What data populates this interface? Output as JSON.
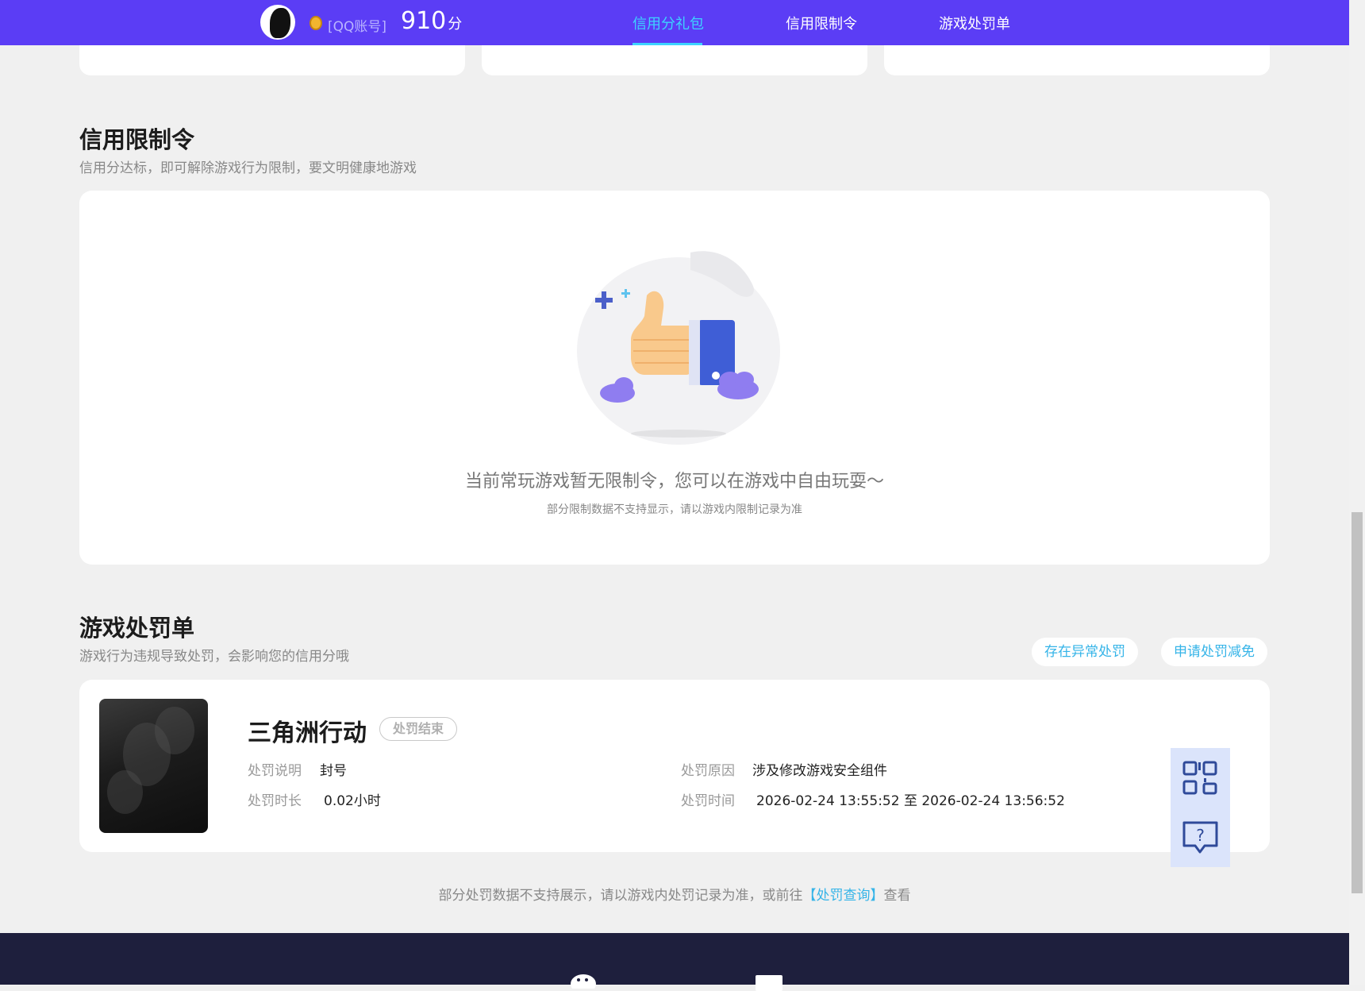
{
  "header": {
    "account_type": "[QQ账号]",
    "score_value": "910",
    "score_unit": "分",
    "tabs": [
      {
        "label": "信用分礼包",
        "active": true
      },
      {
        "label": "信用限制令",
        "active": false
      },
      {
        "label": "游戏处罚单",
        "active": false
      }
    ]
  },
  "restriction_section": {
    "title": "信用限制令",
    "subtitle": "信用分达标，即可解除游戏行为限制，要文明健康地游戏",
    "empty_message": "当前常玩游戏暂无限制令，您可以在游戏中自由玩耍～",
    "empty_note": "部分限制数据不支持显示，请以游戏内限制记录为准"
  },
  "penalty_section": {
    "title": "游戏处罚单",
    "subtitle": "游戏行为违规导致处罚，会影响您的信用分哦",
    "btn_abnormal": "存在异常处罚",
    "btn_reduce": "申请处罚减免",
    "record": {
      "game_name": "三角洲行动",
      "status": "处罚结束",
      "desc_label": "处罚说明",
      "desc_value": "封号",
      "duration_label": "处罚时长",
      "duration_value": "0.02小时",
      "reason_label": "处罚原因",
      "reason_value": "涉及修改游戏安全组件",
      "time_label": "处罚时间",
      "time_value": "2026-02-24 13:55:52 至 2026-02-24 13:56:52"
    },
    "footer_note_prefix": "部分处罚数据不支持展示，请以游戏内处罚记录为准，或前往",
    "footer_note_link": "【处罚查询】",
    "footer_note_suffix": "查看"
  },
  "side_buttons": {
    "qr_icon": "qr-code-icon",
    "help_icon": "help-chat-icon"
  },
  "colors": {
    "nav_bg": "#5b3df5",
    "accent": "#3dd3ff",
    "link": "#35b4e8",
    "footer_bg": "#1e1f3d"
  }
}
